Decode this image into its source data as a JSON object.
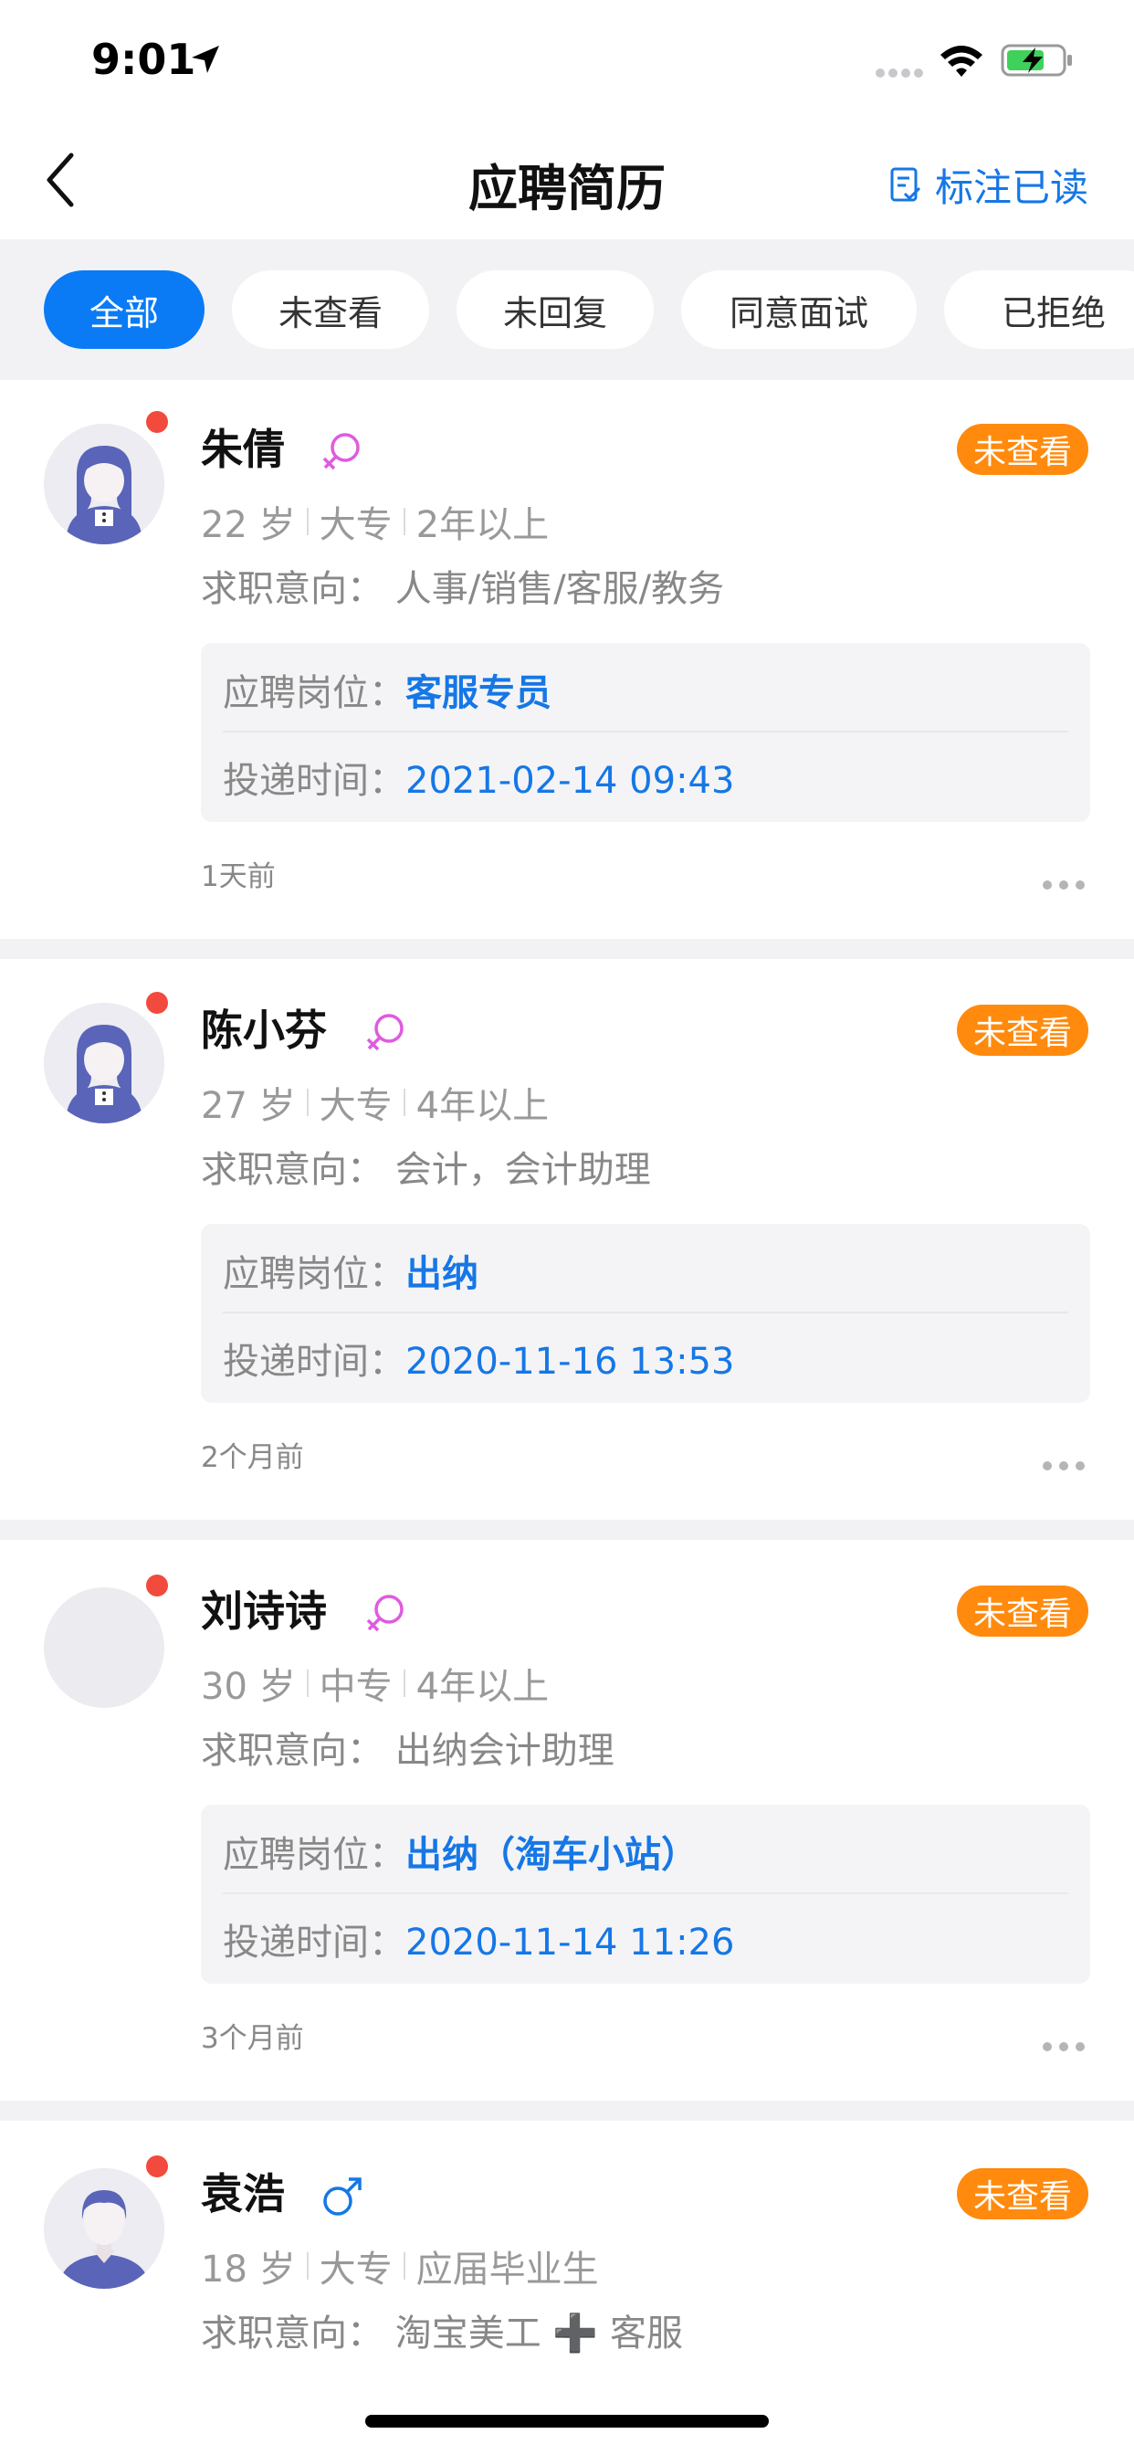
{
  "status_bar": {
    "time": "9:01"
  },
  "header": {
    "title": "应聘简历",
    "mark_read_label": "标注已读"
  },
  "tabs": [
    {
      "label": "全部",
      "active": true
    },
    {
      "label": "未查看",
      "active": false
    },
    {
      "label": "未回复",
      "active": false
    },
    {
      "label": "同意面试",
      "active": false
    },
    {
      "label": "已拒绝",
      "active": false
    }
  ],
  "labels": {
    "job_prefix": "应聘岗位：",
    "time_prefix": "投递时间："
  },
  "candidates": [
    {
      "name": "朱倩",
      "gender": "female",
      "status": "未查看",
      "age": "22 岁",
      "education": "大专",
      "experience": "2年以上",
      "intent": "求职意向：  人事/销售/客服/教务",
      "job": "客服专员",
      "delivered": "2021-02-14 09:43",
      "ago": "1天前"
    },
    {
      "name": "陈小芬",
      "gender": "female",
      "status": "未查看",
      "age": "27 岁",
      "education": "大专",
      "experience": "4年以上",
      "intent": "求职意向：  会计，会计助理",
      "job": "出纳",
      "delivered": "2020-11-16 13:53",
      "ago": "2个月前"
    },
    {
      "name": "刘诗诗",
      "gender": "female",
      "status": "未查看",
      "age": "30 岁",
      "education": "中专",
      "experience": "4年以上",
      "intent": "求职意向：  出纳会计助理",
      "job": "出纳（淘车小站）",
      "delivered": "2020-11-14 11:26",
      "ago": "3个月前"
    },
    {
      "name": "袁浩",
      "gender": "male",
      "status": "未查看",
      "age": "18 岁",
      "education": "大专",
      "experience": "应届毕业生",
      "intent": "求职意向：  淘宝美工 ➕ 客服"
    }
  ],
  "colors": {
    "accent": "#0a7bf5",
    "link": "#1677e6",
    "badge": "#ff8a0d",
    "unread_dot": "#f24a3c",
    "female": "#e05adf",
    "male": "#1677e6"
  }
}
